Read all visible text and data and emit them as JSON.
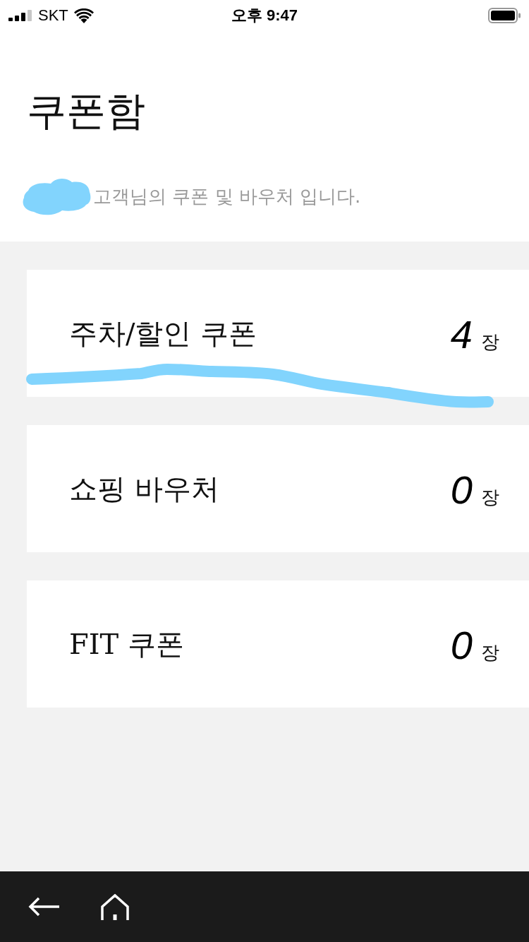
{
  "status_bar": {
    "carrier": "SKT",
    "time": "오후 9:47"
  },
  "header": {
    "title": "쿠폰함",
    "subtitle": "고객님의 쿠폰 및 바우처 입니다."
  },
  "coupons": [
    {
      "label": "주차/할인 쿠폰",
      "count": "4",
      "unit": "장"
    },
    {
      "label": "쇼핑 바우처",
      "count": "0",
      "unit": "장"
    },
    {
      "label": "FIT 쿠폰",
      "count": "0",
      "unit": "장"
    }
  ]
}
